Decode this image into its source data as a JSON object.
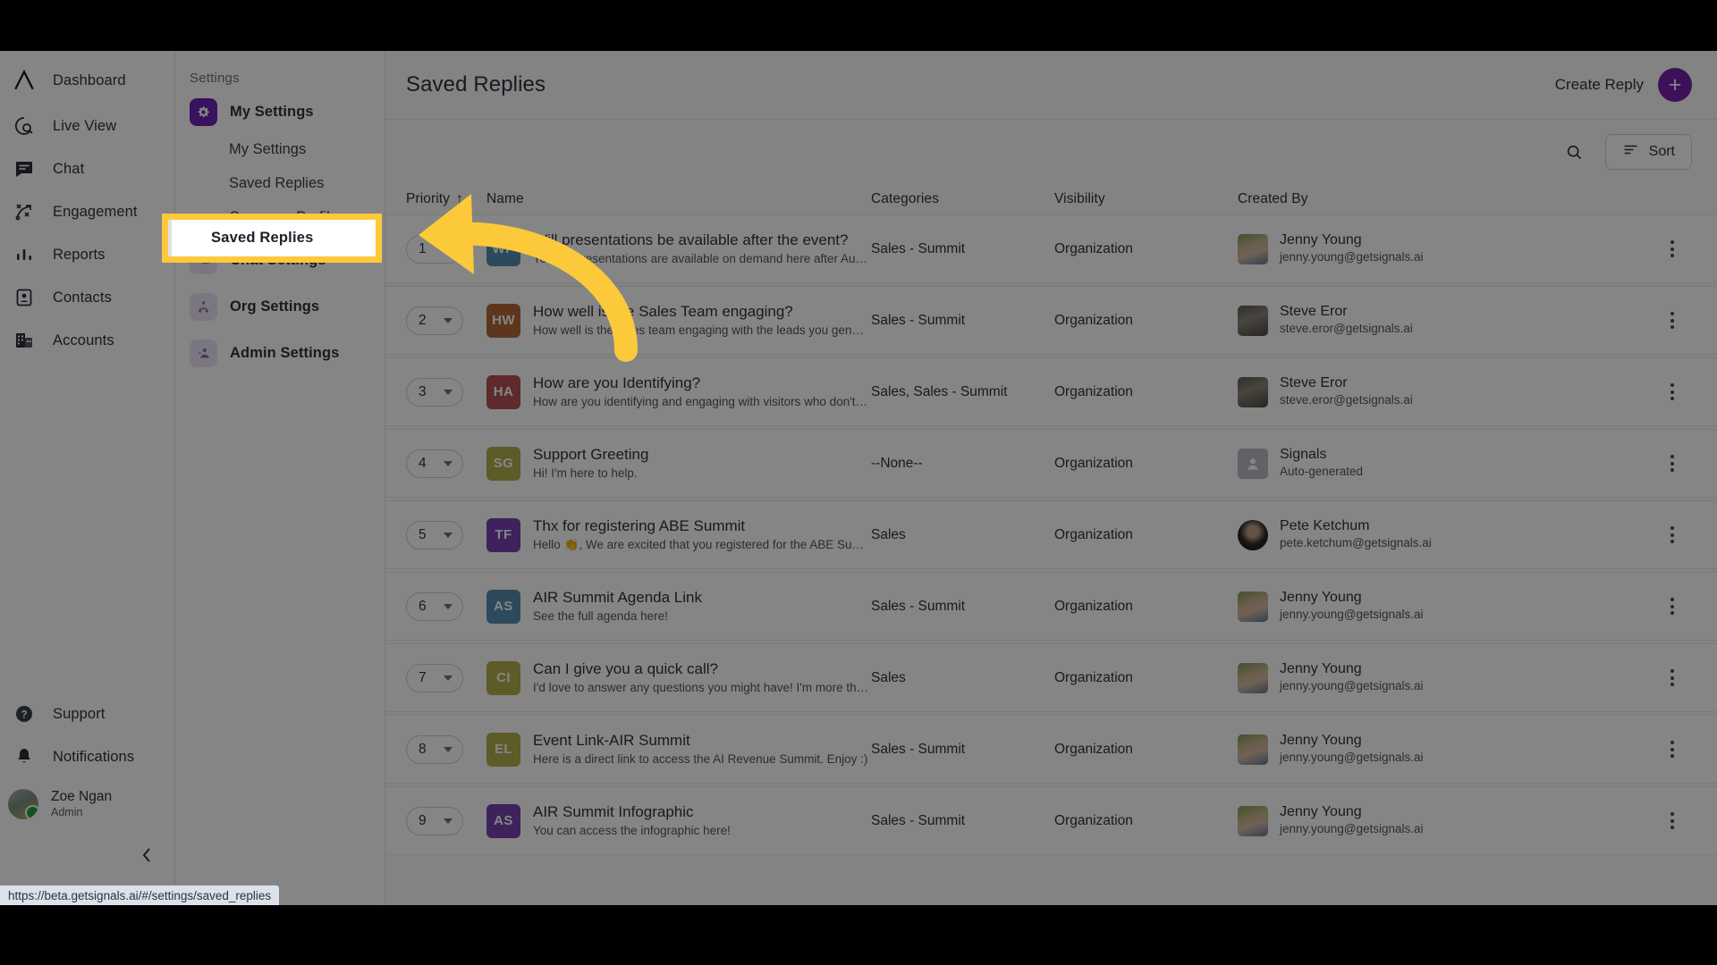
{
  "leftnav": {
    "logo_icon": "chevron-logo-icon",
    "items": [
      {
        "label": "Dashboard",
        "icon": "dashboard-icon"
      },
      {
        "label": "Live View",
        "icon": "live-view-icon"
      },
      {
        "label": "Chat",
        "icon": "chat-icon"
      },
      {
        "label": "Engagement",
        "icon": "engagement-icon"
      },
      {
        "label": "Reports",
        "icon": "reports-icon"
      },
      {
        "label": "Contacts",
        "icon": "contacts-icon"
      },
      {
        "label": "Accounts",
        "icon": "accounts-icon"
      }
    ],
    "bottom": [
      {
        "label": "Support",
        "icon": "help-circle-icon"
      },
      {
        "label": "Notifications",
        "icon": "bell-icon"
      }
    ],
    "user": {
      "name": "Zoe Ngan",
      "role": "Admin",
      "status": "online"
    },
    "collapse_icon": "chevron-left-icon"
  },
  "settings": {
    "title": "Settings",
    "groups": [
      {
        "label": "My Settings",
        "icon": "gear-icon",
        "active": true,
        "sub": [
          "My Settings",
          "Saved Replies",
          "Company Profile"
        ]
      },
      {
        "label": "Chat Settings",
        "icon": "chat-bubbles-icon",
        "active": false,
        "sub": []
      },
      {
        "label": "Org Settings",
        "icon": "org-people-icon",
        "active": false,
        "sub": []
      },
      {
        "label": "Admin Settings",
        "icon": "admin-person-icon",
        "active": false,
        "sub": []
      }
    ],
    "highlight": {
      "label": "Saved Replies",
      "color": "#fcc93b"
    }
  },
  "header": {
    "title": "Saved Replies",
    "create_label": "Create Reply",
    "create_icon": "plus-icon",
    "accent": "#7322ad"
  },
  "toolbar": {
    "search_icon": "search-icon",
    "sort_label": "Sort",
    "sort_icon": "sort-lines-icon"
  },
  "table": {
    "columns": [
      "Priority",
      "Name",
      "Categories",
      "Visibility",
      "Created By"
    ],
    "sort_indicator": "↑",
    "rows": [
      {
        "priority": "1",
        "initials": "WP",
        "color": "#4a86ab",
        "title": "Will presentations be available after the event?",
        "snippet": "Yes, all presentations are available on demand here after Au…",
        "categories": "Sales - Summit",
        "visibility": "Organization",
        "author": "Jenny Young",
        "email": "jenny.young@getsignals.ai",
        "avatar": "av-jenny"
      },
      {
        "priority": "2",
        "initials": "HW",
        "color": "#ab5f2c",
        "title": "How well is the Sales Team engaging?",
        "snippet": "How well is the sales team engaging with the leads you gen…",
        "categories": "Sales - Summit",
        "visibility": "Organization",
        "author": "Steve Eror",
        "email": "steve.eror@getsignals.ai",
        "avatar": "av-steve"
      },
      {
        "priority": "3",
        "initials": "HA",
        "color": "#b0444a",
        "title": "How are you Identifying?",
        "snippet": "How are you identifying and engaging with visitors who don't…",
        "categories": "Sales, Sales - Summit",
        "visibility": "Organization",
        "author": "Steve Eror",
        "email": "steve.eror@getsignals.ai",
        "avatar": "av-steve"
      },
      {
        "priority": "4",
        "initials": "SG",
        "color": "#adaa3e",
        "title": "Support Greeting",
        "snippet": "Hi! I'm here to help.",
        "categories": "--None--",
        "visibility": "Organization",
        "author": "Signals",
        "email": "Auto-generated",
        "avatar": "av-sig"
      },
      {
        "priority": "5",
        "initials": "TF",
        "color": "#6d33ac",
        "title": "Thx for registering ABE Summit",
        "snippet": "Hello 👏, We are excited that you registered for the ABE Sum…",
        "categories": "Sales",
        "visibility": "Organization",
        "author": "Pete Ketchum",
        "email": "pete.ketchum@getsignals.ai",
        "avatar": "av-pete"
      },
      {
        "priority": "6",
        "initials": "AS",
        "color": "#4a86ab",
        "title": "AIR Summit Agenda Link",
        "snippet": "See the full agenda here!",
        "categories": "Sales - Summit",
        "visibility": "Organization",
        "author": "Jenny Young",
        "email": "jenny.young@getsignals.ai",
        "avatar": "av-jenny"
      },
      {
        "priority": "7",
        "initials": "CI",
        "color": "#adaa3e",
        "title": "Can I give you a quick call?",
        "snippet": "I'd love to answer any questions you might have! I'm more th…",
        "categories": "Sales",
        "visibility": "Organization",
        "author": "Jenny Young",
        "email": "jenny.young@getsignals.ai",
        "avatar": "av-jenny"
      },
      {
        "priority": "8",
        "initials": "EL",
        "color": "#adaa3e",
        "title": "Event Link-AIR Summit",
        "snippet": "Here is a direct link to access the AI Revenue Summit. Enjoy :)",
        "categories": "Sales - Summit",
        "visibility": "Organization",
        "author": "Jenny Young",
        "email": "jenny.young@getsignals.ai",
        "avatar": "av-jenny"
      },
      {
        "priority": "9",
        "initials": "AS",
        "color": "#6d33ac",
        "title": "AIR Summit Infographic",
        "snippet": "You can access the infographic here!",
        "categories": "Sales - Summit",
        "visibility": "Organization",
        "author": "Jenny Young",
        "email": "jenny.young@getsignals.ai",
        "avatar": "av-jenny"
      }
    ]
  },
  "statusbar": {
    "url": "https://beta.getsignals.ai/#/settings/saved_replies"
  }
}
